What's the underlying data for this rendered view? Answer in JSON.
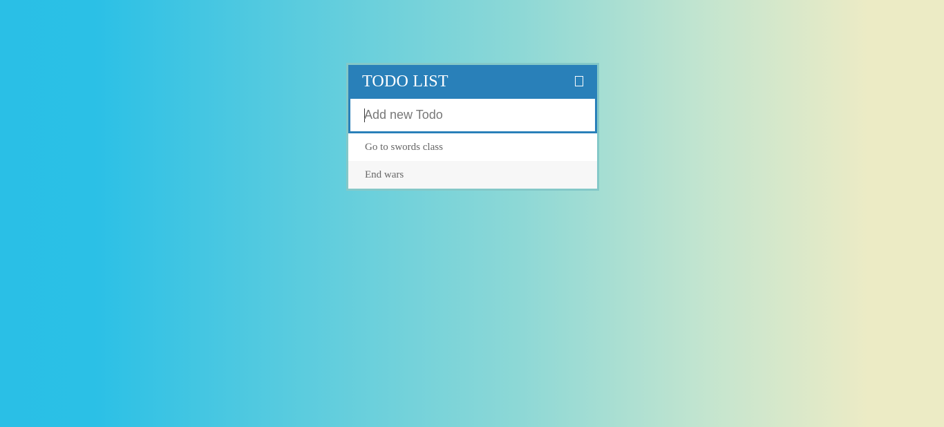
{
  "header": {
    "title": "TODO LIST",
    "toggle_icon": "square-toggle-icon"
  },
  "input": {
    "placeholder": "Add new Todo",
    "value": ""
  },
  "todos": [
    {
      "text": "Go to swords class"
    },
    {
      "text": "End wars"
    }
  ],
  "colors": {
    "header_bg": "#2980b9",
    "gradient_left": "#2abfe6",
    "gradient_right": "#ecebc5",
    "border": "#84c8c8"
  }
}
